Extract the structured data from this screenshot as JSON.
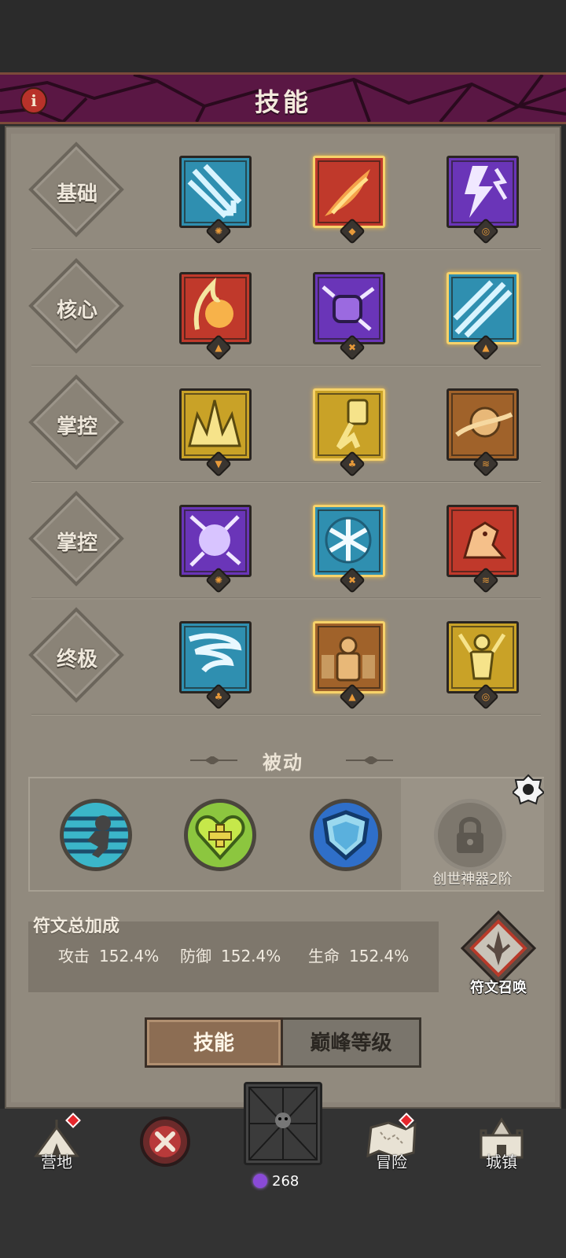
{
  "header": {
    "title": "技能",
    "info_glyph": "i"
  },
  "rows": [
    {
      "label": "基础",
      "skills": [
        {
          "icon": "ice-arrow-icon",
          "theme": "#2f8fb0",
          "selected": false,
          "rune": "✺"
        },
        {
          "icon": "fire-slash-icon",
          "theme": "#c0392b",
          "selected": true,
          "rune": "◆"
        },
        {
          "icon": "lightning-bolt-icon",
          "theme": "#6a35b8",
          "selected": false,
          "rune": "◎"
        }
      ]
    },
    {
      "label": "核心",
      "skills": [
        {
          "icon": "fireball-icon",
          "theme": "#c0392b",
          "selected": false,
          "rune": "▲"
        },
        {
          "icon": "lightning-fist-icon",
          "theme": "#6a35b8",
          "selected": false,
          "rune": "✖"
        },
        {
          "icon": "ice-shards-icon",
          "theme": "#2f8fb0",
          "selected": true,
          "rune": "▲"
        }
      ]
    },
    {
      "label": "掌控",
      "skills": [
        {
          "icon": "golden-crown-icon",
          "theme": "#c9a227",
          "selected": false,
          "rune": "▼"
        },
        {
          "icon": "golden-spirit-icon",
          "theme": "#c9a227",
          "selected": true,
          "rune": "♣"
        },
        {
          "icon": "earth-meteor-icon",
          "theme": "#a0622a",
          "selected": false,
          "rune": "≋"
        }
      ]
    },
    {
      "label": "掌控",
      "skills": [
        {
          "icon": "lightning-orb-icon",
          "theme": "#6a35b8",
          "selected": false,
          "rune": "✺"
        },
        {
          "icon": "snowflake-icon",
          "theme": "#2f8fb0",
          "selected": true,
          "rune": "✖"
        },
        {
          "icon": "fire-beast-icon",
          "theme": "#c0392b",
          "selected": false,
          "rune": "≋"
        }
      ]
    },
    {
      "label": "终极",
      "skills": [
        {
          "icon": "ice-tornado-icon",
          "theme": "#2f8fb0",
          "selected": false,
          "rune": "♣"
        },
        {
          "icon": "summon-army-icon",
          "theme": "#a0622a",
          "selected": true,
          "rune": "▲"
        },
        {
          "icon": "golden-avatar-icon",
          "theme": "#c9a227",
          "selected": false,
          "rune": "◎"
        }
      ]
    }
  ],
  "passive": {
    "title": "被动",
    "slots": [
      {
        "icon": "dash-runner-icon",
        "color": "#3bb6c9"
      },
      {
        "icon": "heart-heal-icon",
        "color": "#8cc63f"
      },
      {
        "icon": "shield-icon",
        "color": "#2f6fc9"
      }
    ],
    "locked_label": "创世神器2阶"
  },
  "rune_bonus": {
    "title": "符文总加成",
    "stats": [
      {
        "name": "攻击",
        "value": "152.4%"
      },
      {
        "name": "防御",
        "value": "152.4%"
      },
      {
        "name": "生命",
        "value": "152.4%"
      }
    ],
    "summon_label": "符文召唤"
  },
  "tabs": {
    "active": "技能",
    "inactive": "巅峰等级"
  },
  "nav": {
    "camp": "营地",
    "adventure": "冒险",
    "town": "城镇",
    "currency": "268"
  }
}
